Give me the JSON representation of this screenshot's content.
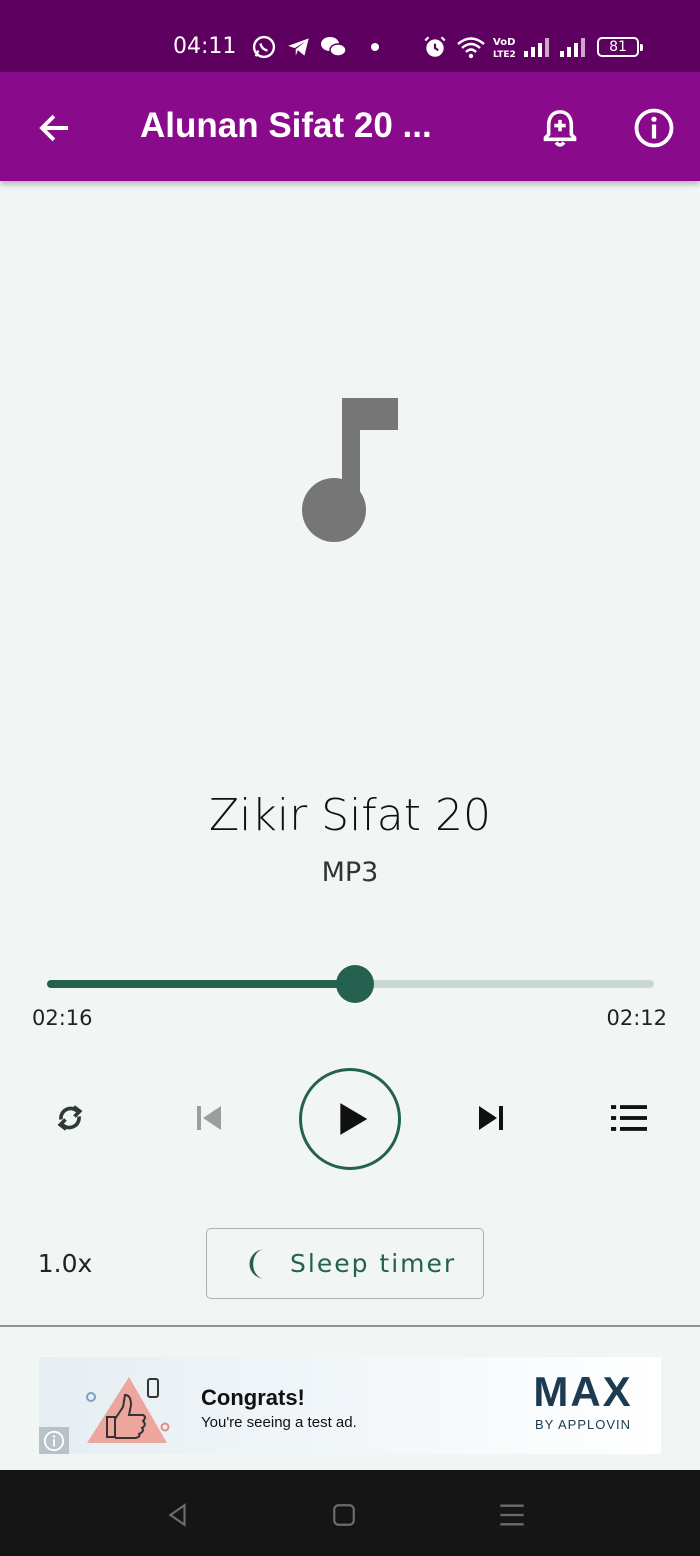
{
  "status_bar": {
    "time": "04:11",
    "battery": "81",
    "icons": [
      "whatsapp-icon",
      "telegram-icon",
      "wechat-icon",
      "dot-icon",
      "alarm-icon",
      "wifi-icon",
      "volte-icon",
      "signal-icon",
      "signal-icon"
    ]
  },
  "app_bar": {
    "title": "Alunan Sifat 20 ...",
    "color": "#8a0a8c",
    "icons": [
      "back-arrow-icon",
      "alarm-add-icon",
      "info-icon"
    ]
  },
  "player": {
    "artwork_icon": "music-note-icon",
    "title": "Zikir Sifat 20",
    "subtitle": "MP3",
    "elapsed": "02:16",
    "remaining": "02:12",
    "progress": 0.507,
    "accent": "#24614f",
    "controls": [
      "repeat-icon",
      "skip-previous-icon",
      "play-icon",
      "skip-next-icon",
      "queue-icon"
    ],
    "speed": "1.0x",
    "sleep_timer_label": "Sleep timer"
  },
  "ad": {
    "headline": "Congrats!",
    "body": "You're seeing a test ad.",
    "brand": "MAX",
    "brand_sub": "BY APPLOVIN"
  },
  "nav_bar": {
    "icons": [
      "nav-back-icon",
      "nav-home-icon",
      "nav-recents-icon"
    ]
  }
}
